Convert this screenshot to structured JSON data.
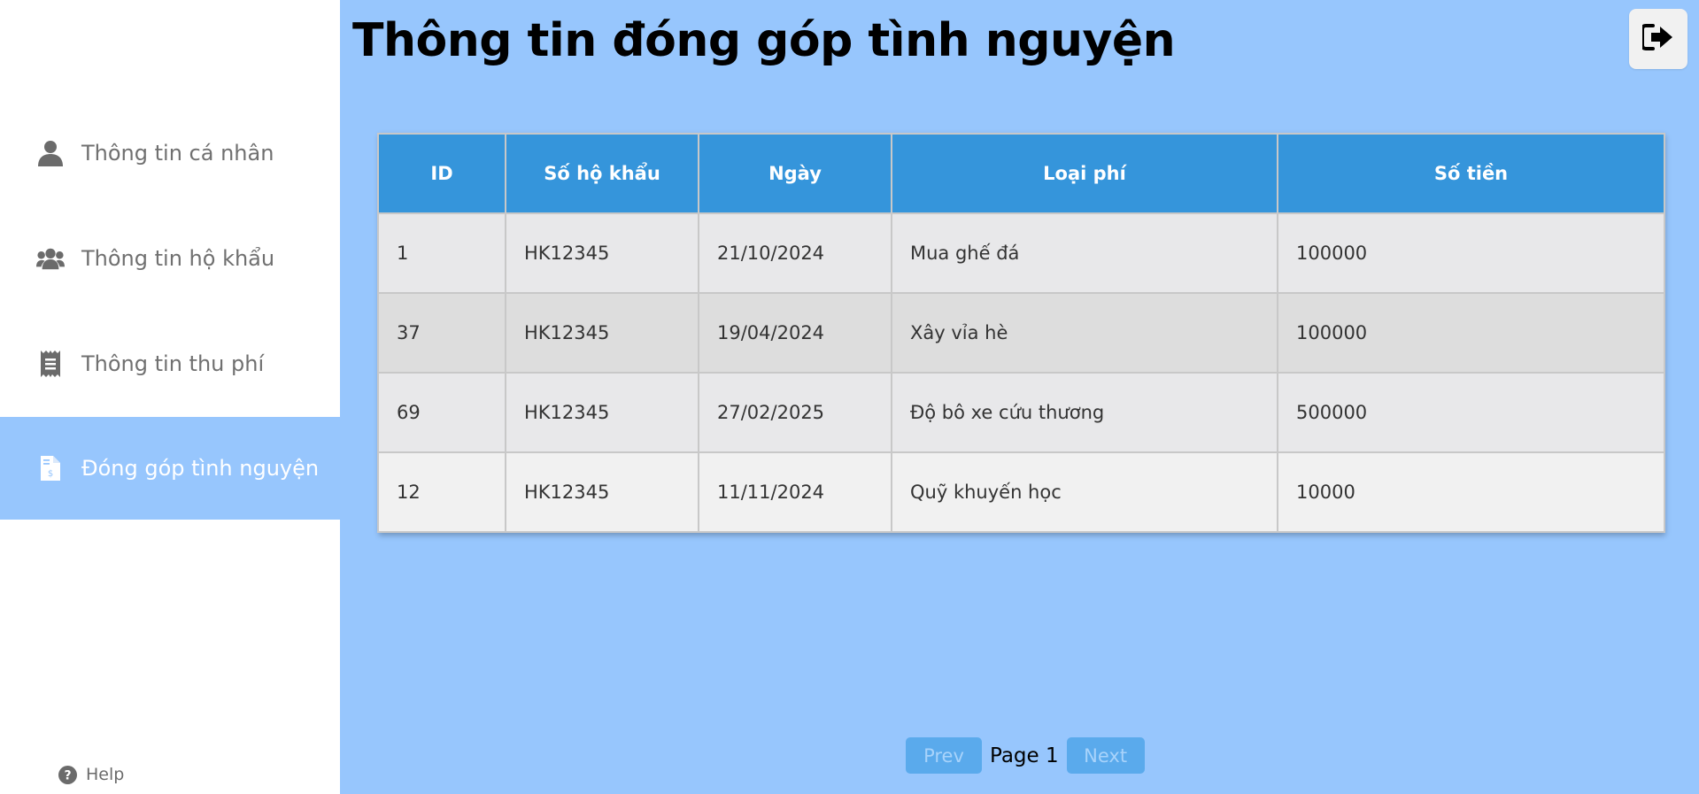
{
  "sidebar": {
    "items": [
      {
        "label": "Thông tin cá nhân",
        "icon": "user-icon"
      },
      {
        "label": "Thông tin hộ khẩu",
        "icon": "users-icon"
      },
      {
        "label": "Thông tin thu phí",
        "icon": "receipt-icon"
      },
      {
        "label": "Đóng góp tình nguyện",
        "icon": "invoice-dollar-icon",
        "active": true
      }
    ],
    "help_label": "Help"
  },
  "header": {
    "title": "Thông tin đóng góp tình nguyện",
    "logout_icon": "sign-out-icon"
  },
  "table": {
    "columns": [
      "ID",
      "Số hộ khẩu",
      "Ngày",
      "Loại phí",
      "Số tiền"
    ],
    "rows": [
      [
        "1",
        "HK12345",
        "21/10/2024",
        "Mua ghế đá",
        "100000"
      ],
      [
        "37",
        "HK12345",
        "19/04/2024",
        "Xây vỉa hè",
        "100000"
      ],
      [
        "69",
        "HK12345",
        "27/02/2025",
        "Độ bô xe cứu thương",
        "500000"
      ],
      [
        "12",
        "HK12345",
        "11/11/2024",
        "Quỹ khuyến học",
        "10000"
      ]
    ]
  },
  "pagination": {
    "prev_label": "Prev",
    "page_label": "Page 1",
    "next_label": "Next"
  },
  "colors": {
    "background": "#97c6fd",
    "header_row": "#3595db",
    "active_nav": "#97c6fd",
    "pager_button": "#5aaaec"
  }
}
